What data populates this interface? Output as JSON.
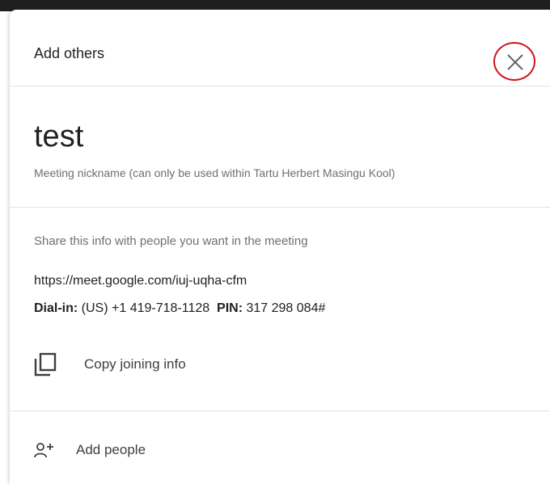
{
  "dialog": {
    "title": "Add others",
    "close_icon": "close-icon",
    "highlight_color": "#d0121b"
  },
  "meeting": {
    "nickname": "test",
    "nickname_caption": "Meeting nickname (can only be used within Tartu Herbert Masingu Kool)"
  },
  "share": {
    "caption": "Share this info with people you want in the meeting",
    "link": "https://meet.google.com/iuj-uqha-cfm",
    "dial_label": "Dial-in:",
    "dial_number": "(US) +1 419-718-1128",
    "pin_label": "PIN:",
    "pin_value": "317 298 084#"
  },
  "actions": {
    "copy_label": "Copy joining info",
    "copy_icon": "copy-icon",
    "add_people_label": "Add people",
    "add_people_icon": "add-person-icon"
  }
}
